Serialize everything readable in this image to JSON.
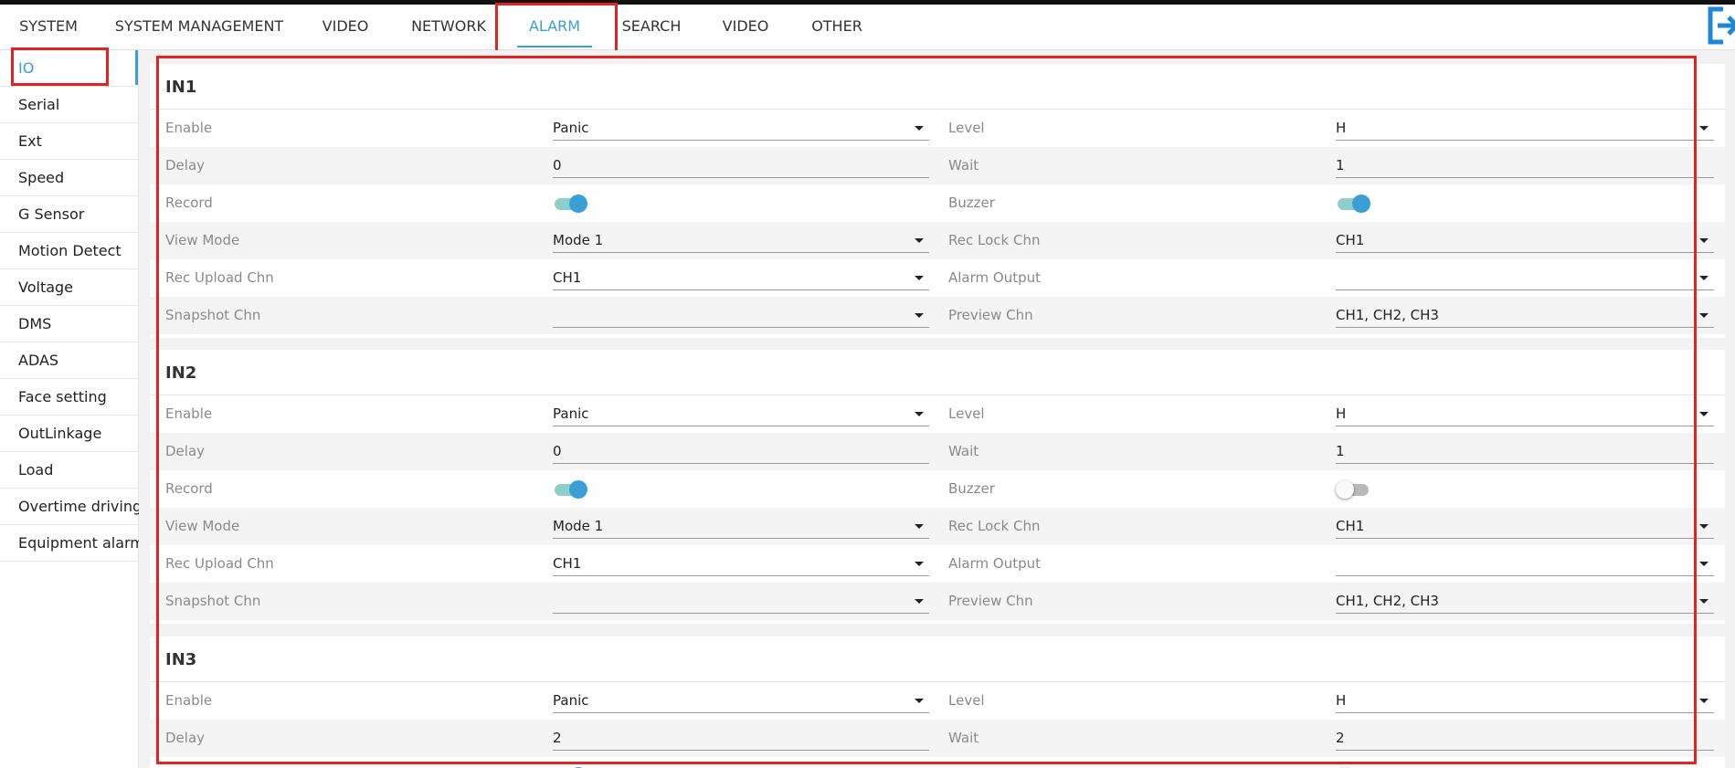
{
  "colors": {
    "accent": "#3a9fd6",
    "highlight": "#e32222",
    "toggle_on_track": "#8fcfc9"
  },
  "topnav": {
    "tabs": [
      {
        "label": "SYSTEM"
      },
      {
        "label": "SYSTEM MANAGEMENT"
      },
      {
        "label": "VIDEO"
      },
      {
        "label": "NETWORK"
      },
      {
        "label": "ALARM",
        "active": true
      },
      {
        "label": "SEARCH"
      },
      {
        "label": "VIDEO"
      },
      {
        "label": "OTHER"
      }
    ],
    "logout_icon": "logout-icon"
  },
  "sidebar": {
    "items": [
      {
        "label": "IO",
        "active": true
      },
      {
        "label": "Serial"
      },
      {
        "label": "Ext"
      },
      {
        "label": "Speed"
      },
      {
        "label": "G Sensor"
      },
      {
        "label": "Motion Detect"
      },
      {
        "label": "Voltage"
      },
      {
        "label": "DMS"
      },
      {
        "label": "ADAS"
      },
      {
        "label": "Face setting"
      },
      {
        "label": "OutLinkage"
      },
      {
        "label": "Load"
      },
      {
        "label": "Overtime driving"
      },
      {
        "label": "Equipment alarm"
      }
    ]
  },
  "sections": [
    {
      "title": "IN1",
      "enable_label": "Enable",
      "enable": "Panic",
      "level_label": "Level",
      "level": "H",
      "delay_label": "Delay",
      "delay": "0",
      "wait_label": "Wait",
      "wait": "1",
      "record_label": "Record",
      "record_on": true,
      "buzzer_label": "Buzzer",
      "buzzer_on": true,
      "view_mode_label": "View Mode",
      "view_mode": "Mode 1",
      "rec_lock_label": "Rec Lock Chn",
      "rec_lock": "CH1",
      "rec_upload_label": "Rec Upload Chn",
      "rec_upload": "CH1",
      "alarm_output_label": "Alarm Output",
      "alarm_output": "",
      "snapshot_label": "Snapshot Chn",
      "snapshot": "",
      "preview_label": "Preview Chn",
      "preview": "CH1, CH2, CH3"
    },
    {
      "title": "IN2",
      "enable_label": "Enable",
      "enable": "Panic",
      "level_label": "Level",
      "level": "H",
      "delay_label": "Delay",
      "delay": "0",
      "wait_label": "Wait",
      "wait": "1",
      "record_label": "Record",
      "record_on": true,
      "buzzer_label": "Buzzer",
      "buzzer_on": false,
      "view_mode_label": "View Mode",
      "view_mode": "Mode 1",
      "rec_lock_label": "Rec Lock Chn",
      "rec_lock": "CH1",
      "rec_upload_label": "Rec Upload Chn",
      "rec_upload": "CH1",
      "alarm_output_label": "Alarm Output",
      "alarm_output": "",
      "snapshot_label": "Snapshot Chn",
      "snapshot": "",
      "preview_label": "Preview Chn",
      "preview": "CH1, CH2, CH3"
    },
    {
      "title": "IN3",
      "enable_label": "Enable",
      "enable": "Panic",
      "level_label": "Level",
      "level": "H",
      "delay_label": "Delay",
      "delay": "2",
      "wait_label": "Wait",
      "wait": "2",
      "record_on": true,
      "buzzer_on": false
    }
  ]
}
